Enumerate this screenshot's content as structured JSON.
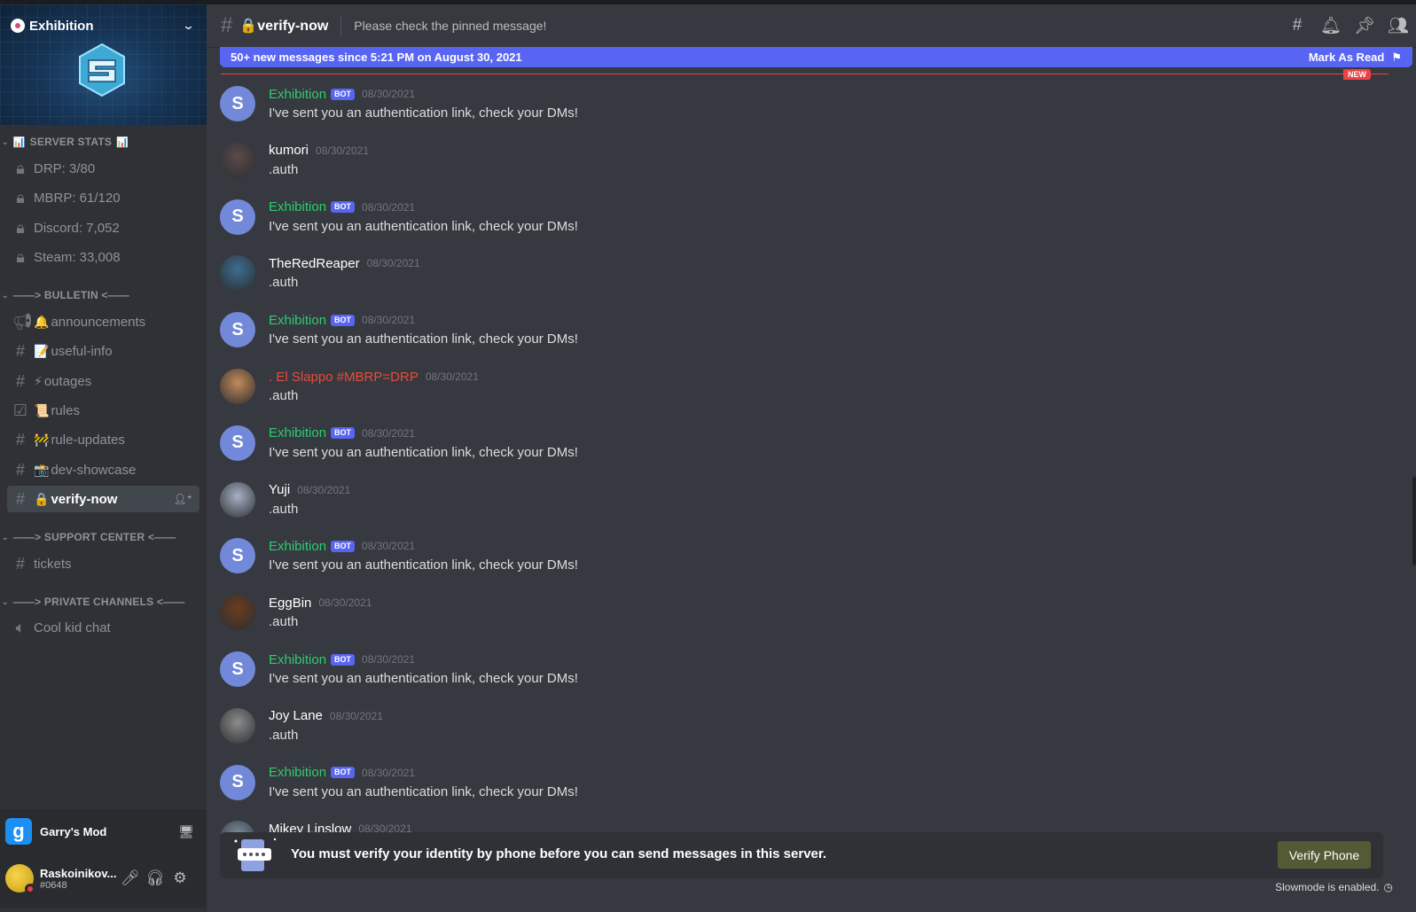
{
  "server": {
    "name": "Exhibition"
  },
  "categories": {
    "server_stats": "SERVER STATS",
    "bulletin": "——> BULLETIN <——",
    "support": "——> SUPPORT CENTER <——",
    "private": "——> PRIVATE CHANNELS <——"
  },
  "stats_channels": [
    {
      "label": "DRP: 3/80"
    },
    {
      "label": "MBRP: 61/120"
    },
    {
      "label": "Discord: 7,052"
    },
    {
      "label": "Steam: 33,008"
    }
  ],
  "bulletin_channels": [
    {
      "emoji": "🔔",
      "label": "announcements",
      "icon": "megaphone-icon"
    },
    {
      "emoji": "📝",
      "label": "useful-info",
      "icon": "hash-icon"
    },
    {
      "emoji": "⚡",
      "label": "outages",
      "icon": "hash-icon"
    },
    {
      "emoji": "📜",
      "label": "rules",
      "icon": "rules-checkbox-icon"
    },
    {
      "emoji": "🚧",
      "label": "rule-updates",
      "icon": "hash-icon"
    },
    {
      "emoji": "📸",
      "label": "dev-showcase",
      "icon": "hash-icon"
    },
    {
      "emoji": "🔒",
      "label": "verify-now",
      "icon": "hash-icon",
      "active": true
    }
  ],
  "support_channels": [
    {
      "label": "tickets"
    }
  ],
  "private_channels": [
    {
      "label": "Cool kid chat"
    }
  ],
  "activity": {
    "game": "Garry's Mod",
    "icon_letter": "g"
  },
  "user": {
    "name": "Raskoinikov...",
    "tag": "#0648"
  },
  "header": {
    "channel": "verify-now",
    "channel_emoji": "🔒",
    "topic": "Please check the pinned message!"
  },
  "new_bar": {
    "text": "50+ new messages since 5:21 PM on August 30, 2021",
    "mark_label": "Mark As Read",
    "new_pill": "NEW"
  },
  "messages": [
    {
      "author": "Exhibition",
      "bot": true,
      "time": "08/30/2021",
      "text": "I've sent you an authentication link, check your DMs!"
    },
    {
      "author": "kumori",
      "bot": false,
      "time": "08/30/2021",
      "text": ".auth"
    },
    {
      "author": "Exhibition",
      "bot": true,
      "time": "08/30/2021",
      "text": "I've sent you an authentication link, check your DMs!"
    },
    {
      "author": "TheRedReaper",
      "bot": false,
      "time": "08/30/2021",
      "text": ".auth"
    },
    {
      "author": "Exhibition",
      "bot": true,
      "time": "08/30/2021",
      "text": "I've sent you an authentication link, check your DMs!"
    },
    {
      "author": ". El Slappo #MBRP=DRP",
      "bot": false,
      "red": true,
      "time": "08/30/2021",
      "text": ".auth"
    },
    {
      "author": "Exhibition",
      "bot": true,
      "time": "08/30/2021",
      "text": "I've sent you an authentication link, check your DMs!"
    },
    {
      "author": "Yuji",
      "bot": false,
      "time": "08/30/2021",
      "text": ".auth"
    },
    {
      "author": "Exhibition",
      "bot": true,
      "time": "08/30/2021",
      "text": "I've sent you an authentication link, check your DMs!"
    },
    {
      "author": "EggBin",
      "bot": false,
      "time": "08/30/2021",
      "text": ".auth"
    },
    {
      "author": "Exhibition",
      "bot": true,
      "time": "08/30/2021",
      "text": "I've sent you an authentication link, check your DMs!"
    },
    {
      "author": "Joy Lane",
      "bot": false,
      "time": "08/30/2021",
      "text": ".auth"
    },
    {
      "author": "Exhibition",
      "bot": true,
      "time": "08/30/2021",
      "text": "I've sent you an authentication link, check your DMs!"
    },
    {
      "author": "Mikey Linslow",
      "bot": false,
      "time": "08/30/2021",
      "text": ""
    }
  ],
  "bot_badge": "BOT",
  "verify": {
    "text": "You must verify your identity by phone before you can send messages in this server.",
    "button": "Verify Phone"
  },
  "slowmode": "Slowmode is enabled.",
  "colors": {
    "accent": "#5865f2",
    "bot_name": "#2ecc71",
    "red_name": "#e74c3c",
    "new_divider": "#ed4245"
  }
}
